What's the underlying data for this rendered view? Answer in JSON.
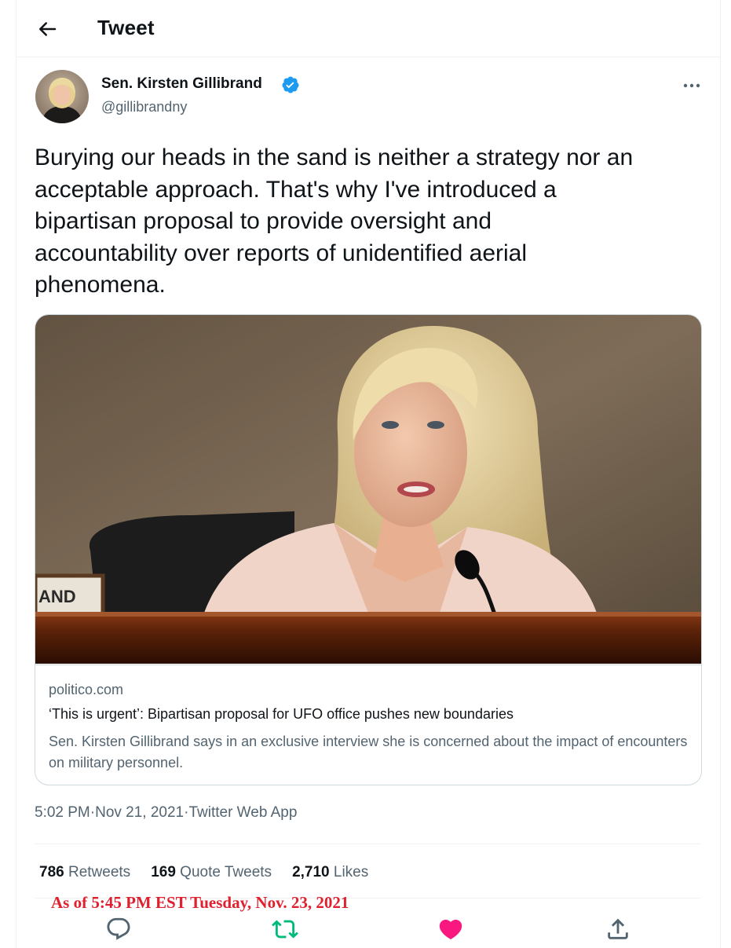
{
  "header": {
    "title": "Tweet"
  },
  "author": {
    "name": "Sen. Kirsten Gillibrand",
    "handle": "@gillibrandny"
  },
  "tweet": {
    "text": "Burying our heads in the sand is neither a strategy nor an\nacceptable approach. That's why I've introduced a\nbipartisan proposal to provide oversight and\naccountability over reports of unidentified aerial\nphenomena."
  },
  "card": {
    "domain": "politico.com",
    "title": "‘This is urgent’: Bipartisan proposal for UFO office pushes new boundaries",
    "description": "Sen. Kirsten Gillibrand says in an exclusive interview she is concerned about the impact of encounters on military personnel.",
    "nameplate": "AND"
  },
  "meta": {
    "time": "5:02 PM",
    "sep": " · ",
    "date": "Nov 21, 2021",
    "source": "Twitter Web App"
  },
  "stats": {
    "retweets_count": "786",
    "retweets_label": "Retweets",
    "quotes_count": "169",
    "quotes_label": "Quote Tweets",
    "likes_count": "2,710",
    "likes_label": "Likes"
  },
  "annotation": "As of 5:45 PM EST Tuesday, Nov. 23, 2021",
  "actions": {
    "reply_icon": "reply-icon",
    "retweet_icon": "retweet-icon",
    "like_icon": "heart-icon",
    "share_icon": "share-icon",
    "retweet_color": "#00ba7c",
    "like_color": "#f91880"
  },
  "colors": {
    "verified": "#1d9bf0",
    "secondary_text": "#536471",
    "annotation": "#e0202f"
  }
}
